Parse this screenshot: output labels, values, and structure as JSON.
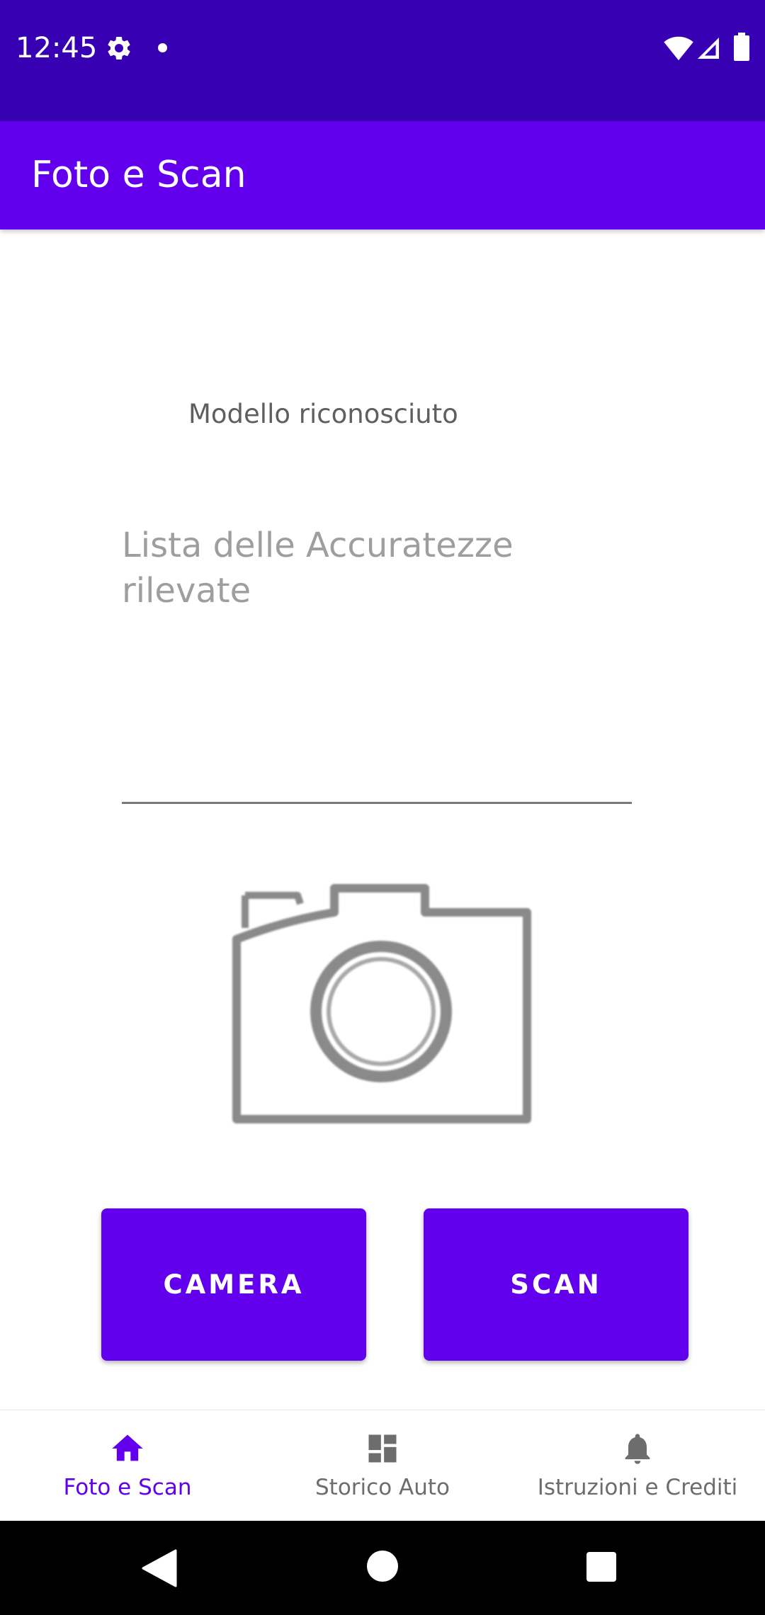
{
  "status_bar": {
    "time": "12:45",
    "icons": [
      "gear-icon",
      "notification-dot-icon",
      "wifi-icon",
      "signal-icon",
      "battery-icon"
    ]
  },
  "app_bar": {
    "title": "Foto e Scan"
  },
  "main": {
    "model_label": "Modello riconosciuto",
    "accuracy_placeholder": "Lista delle Accuratezze rilevate",
    "image_icon": "camera-icon",
    "buttons": {
      "camera": "CAMERA",
      "scan": "SCAN"
    }
  },
  "bottom_nav": {
    "items": [
      {
        "label": "Foto e Scan",
        "icon": "home-icon",
        "active": true
      },
      {
        "label": "Storico Auto",
        "icon": "dashboard-icon",
        "active": false
      },
      {
        "label": "Istruzioni e Crediti",
        "icon": "bell-icon",
        "active": false
      }
    ]
  },
  "colors": {
    "status_bar": "#3700B3",
    "primary": "#6200EE",
    "inactive_nav": "#6d6d6d",
    "placeholder": "#9e9e9e"
  }
}
